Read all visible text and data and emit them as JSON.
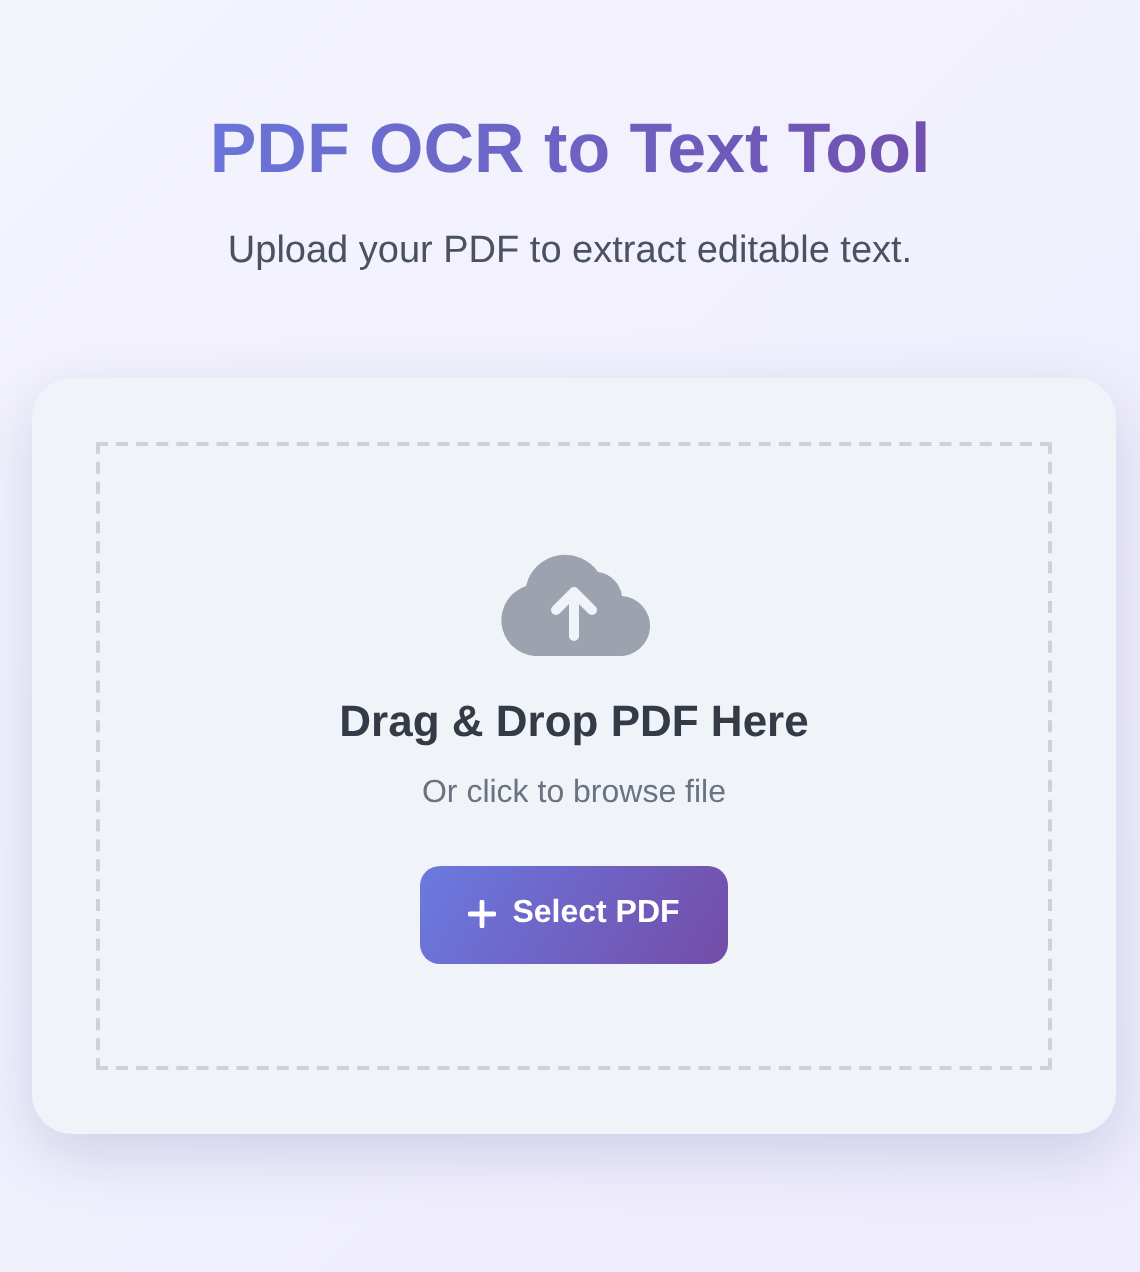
{
  "header": {
    "title": "PDF OCR to Text Tool",
    "subtitle": "Upload your PDF to extract editable text."
  },
  "dropzone": {
    "heading": "Drag & Drop PDF Here",
    "hint": "Or click to browse file",
    "button": "Select PDF"
  }
}
